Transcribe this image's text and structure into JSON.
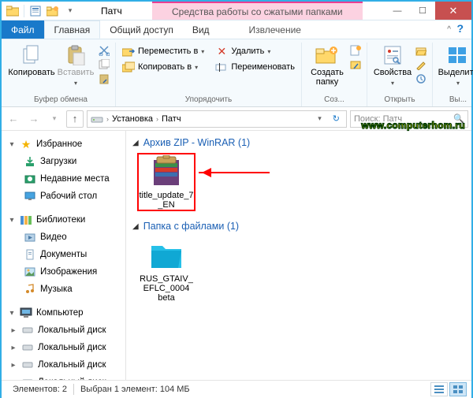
{
  "window": {
    "title": "Патч",
    "context_title": "Средства работы со сжатыми папками"
  },
  "tabs": {
    "file": "Файл",
    "home": "Главная",
    "share": "Общий доступ",
    "view": "Вид",
    "extract": "Извлечение"
  },
  "ribbon": {
    "clipboard": {
      "copy": "Копировать",
      "paste": "Вставить",
      "label": "Буфер обмена"
    },
    "organize": {
      "move_to": "Переместить в",
      "copy_to": "Копировать в",
      "delete": "Удалить",
      "rename": "Переименовать",
      "label": "Упорядочить"
    },
    "new": {
      "new_folder": "Создать папку",
      "label": "Соз..."
    },
    "open": {
      "properties": "Свойства",
      "label": "Открыть"
    },
    "select": {
      "select_all": "Выделить",
      "label": "Вы..."
    }
  },
  "breadcrumb": {
    "items": [
      "Установка",
      "Патч"
    ]
  },
  "search": {
    "placeholder": "Поиск: Патч"
  },
  "nav": {
    "favorites": {
      "label": "Избранное",
      "items": [
        "Загрузки",
        "Недавние места",
        "Рабочий стол"
      ]
    },
    "libraries": {
      "label": "Библиотеки",
      "items": [
        "Видео",
        "Документы",
        "Изображения",
        "Музыка"
      ]
    },
    "computer": {
      "label": "Компьютер",
      "items": [
        "Локальный диск",
        "Локальный диск",
        "Локальный диск",
        "Локальный диск"
      ]
    }
  },
  "content": {
    "groups": [
      {
        "title": "Архив ZIP - WinRAR (1)",
        "items": [
          {
            "name": "title_update_7_EN",
            "selected": true,
            "kind": "winrar"
          }
        ]
      },
      {
        "title": "Папка с файлами (1)",
        "items": [
          {
            "name": "RUS_GTAIV_EFLC_0004 beta",
            "selected": false,
            "kind": "folder"
          }
        ]
      }
    ]
  },
  "statusbar": {
    "count_label": "Элементов: 2",
    "selection_label": "Выбран 1 элемент: 104 МБ"
  },
  "watermark": "www.computerhom.ru"
}
